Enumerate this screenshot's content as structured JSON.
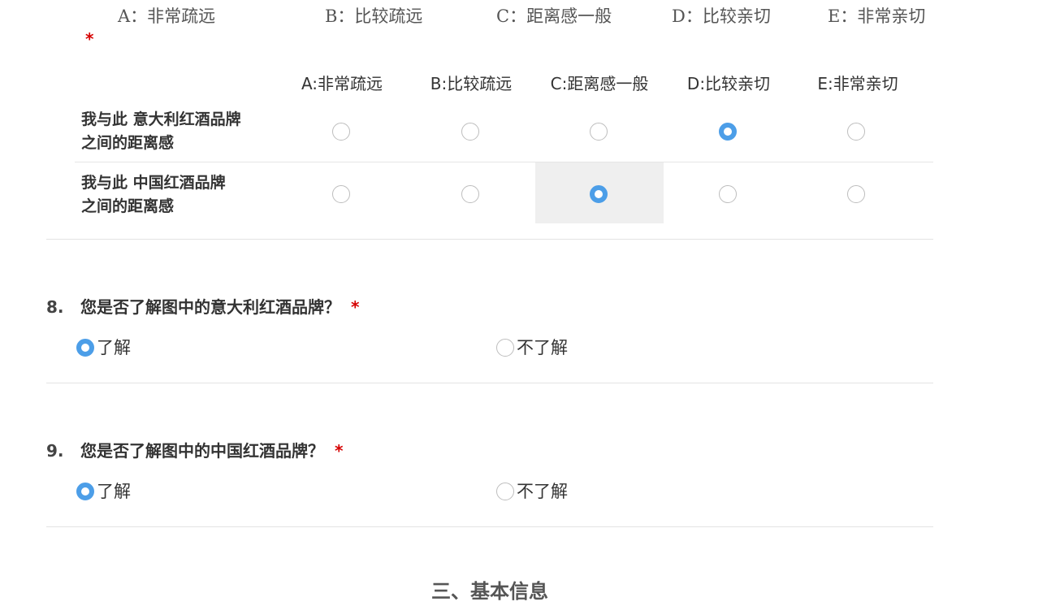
{
  "scale_image": {
    "labels": [
      "A：非常疏远",
      "B：比较疏远",
      "C：距离感一般",
      "D：比较亲切",
      "E：非常亲切"
    ]
  },
  "required_mark": "*",
  "matrix": {
    "columns": [
      "A:非常疏远",
      "B:比较疏远",
      "C:距离感一般",
      "D:比较亲切",
      "E:非常亲切"
    ],
    "rows": [
      {
        "label_line1": "我与此 意大利红酒品牌",
        "label_line2": "之间的距离感",
        "selected_index": 3
      },
      {
        "label_line1": "我与此 中国红酒品牌",
        "label_line2": "之间的距离感",
        "selected_index": 2
      }
    ]
  },
  "questions": [
    {
      "number": "8.",
      "title": "您是否了解图中的意大利红酒品牌？",
      "required": "*",
      "options": [
        "了解",
        "不了解"
      ],
      "selected_index": 0
    },
    {
      "number": "9.",
      "title": "您是否了解图中的中国红酒品牌？",
      "required": "*",
      "options": [
        "了解",
        "不了解"
      ],
      "selected_index": 0
    }
  ],
  "section": {
    "title": "三、基本信息"
  },
  "colors": {
    "accent": "#4c9ee8",
    "required": "#d60000",
    "hover_cell": "#efefef",
    "divider": "#e3e3e3"
  }
}
